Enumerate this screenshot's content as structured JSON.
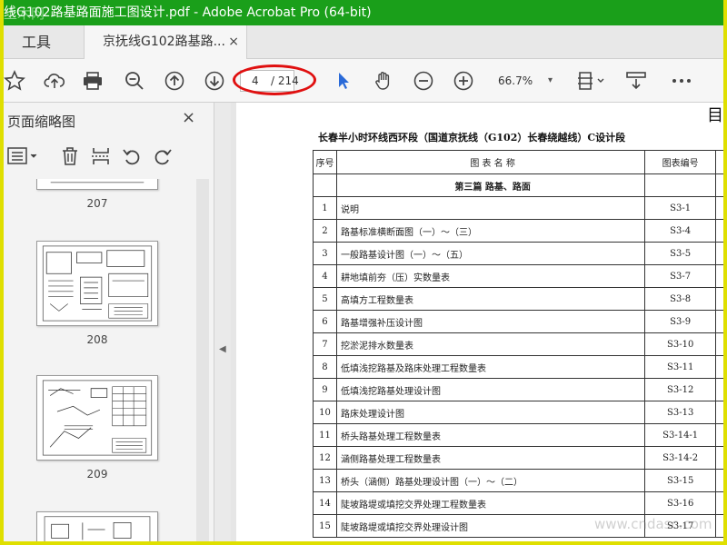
{
  "window": {
    "title": "线G102路基路面施工图设计.pdf - Adobe Acrobat Pro (64-bit)"
  },
  "tabs": {
    "tools_label": "工具",
    "doc_label": "京抚线G102路基路...",
    "close_glyph": "×"
  },
  "toolbar": {
    "current_page": "4",
    "total_pages": "/ 214",
    "zoom": "66.7%",
    "zoom_caret": "▾",
    "accent": "#2a6ad8",
    "highlight_color": "#e01010"
  },
  "sidebar": {
    "title": "页面缩略图",
    "close_glyph": "×",
    "thumbnails": [
      {
        "label": "207"
      },
      {
        "label": "208"
      },
      {
        "label": "209"
      }
    ]
  },
  "document": {
    "corner_char": "目",
    "header": "长春半小时环线西环段（国道京抚线（G102）长春绕越线）C设计段",
    "table": {
      "headers": [
        "序号",
        "图 表 名 称",
        "图表编号"
      ],
      "section": "第三篇  路基、路面",
      "rows": [
        [
          "1",
          "说明",
          "S3-1"
        ],
        [
          "2",
          "路基标准横断面图（一）～（三）",
          "S3-4"
        ],
        [
          "3",
          "一般路基设计图（一）～（五）",
          "S3-5"
        ],
        [
          "4",
          "耕地填前夯（压）实数量表",
          "S3-7"
        ],
        [
          "5",
          "高填方工程数量表",
          "S3-8"
        ],
        [
          "6",
          "路基增强补压设计图",
          "S3-9"
        ],
        [
          "7",
          "挖淤泥排水数量表",
          "S3-10"
        ],
        [
          "8",
          "低填浅挖路基及路床处理工程数量表",
          "S3-11"
        ],
        [
          "9",
          "低填浅挖路基处理设计图",
          "S3-12"
        ],
        [
          "10",
          "路床处理设计图",
          "S3-13"
        ],
        [
          "11",
          "桥头路基处理工程数量表",
          "S3-14-1"
        ],
        [
          "12",
          "涵侧路基处理工程数量表",
          "S3-14-2"
        ],
        [
          "13",
          "桥头（涵侧）路基处理设计图（一）～（二）",
          "S3-15"
        ],
        [
          "14",
          "陡坡路堤或填挖交界处理工程数量表",
          "S3-16"
        ],
        [
          "15",
          "陡坡路堤或填挖交界处理设计图",
          "S3-17"
        ]
      ]
    }
  },
  "watermarks": {
    "top": "土木网",
    "bottom": "www.cndasc.com"
  }
}
